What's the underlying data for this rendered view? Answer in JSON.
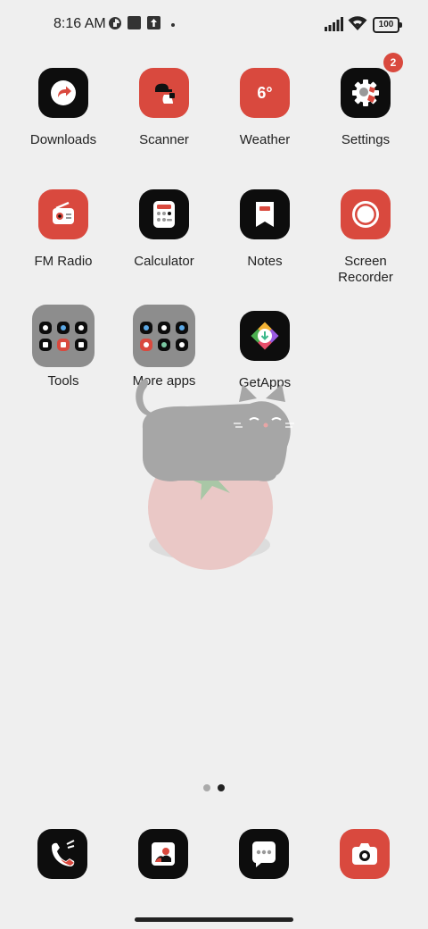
{
  "status_bar": {
    "time": "8:16 AM",
    "battery": "100",
    "icons": [
      "data-saver-icon",
      "square-notification-icon",
      "upload-notification-icon",
      "signal-icon",
      "wifi-icon",
      "battery-icon"
    ]
  },
  "apps": [
    {
      "label": "Downloads",
      "icon": "downloads-icon"
    },
    {
      "label": "Scanner",
      "icon": "scanner-icon"
    },
    {
      "label": "Weather",
      "icon": "weather-icon",
      "tile_text": "6°"
    },
    {
      "label": "Settings",
      "icon": "settings-icon",
      "badge": "2"
    },
    {
      "label": "FM Radio",
      "icon": "radio-icon"
    },
    {
      "label": "Calculator",
      "icon": "calculator-icon"
    },
    {
      "label": "Notes",
      "icon": "notes-icon"
    },
    {
      "label": "Screen Recorder",
      "line1": "Screen",
      "line2": "Recorder",
      "icon": "screen-recorder-icon"
    },
    {
      "label": "Tools",
      "icon": "folder-icon"
    },
    {
      "label": "More apps",
      "icon": "folder-icon"
    },
    {
      "label": "GetApps",
      "icon": "getapps-icon"
    }
  ],
  "pager": {
    "count": 2,
    "active": 2
  },
  "dock": [
    {
      "name": "phone",
      "icon": "phone-icon"
    },
    {
      "name": "gallery",
      "icon": "gallery-icon"
    },
    {
      "name": "messages",
      "icon": "messages-icon"
    },
    {
      "name": "camera",
      "icon": "camera-icon"
    }
  ],
  "colors": {
    "accent": "#d9493e",
    "tile_dark": "#0d0d0d",
    "background": "#efefef"
  }
}
